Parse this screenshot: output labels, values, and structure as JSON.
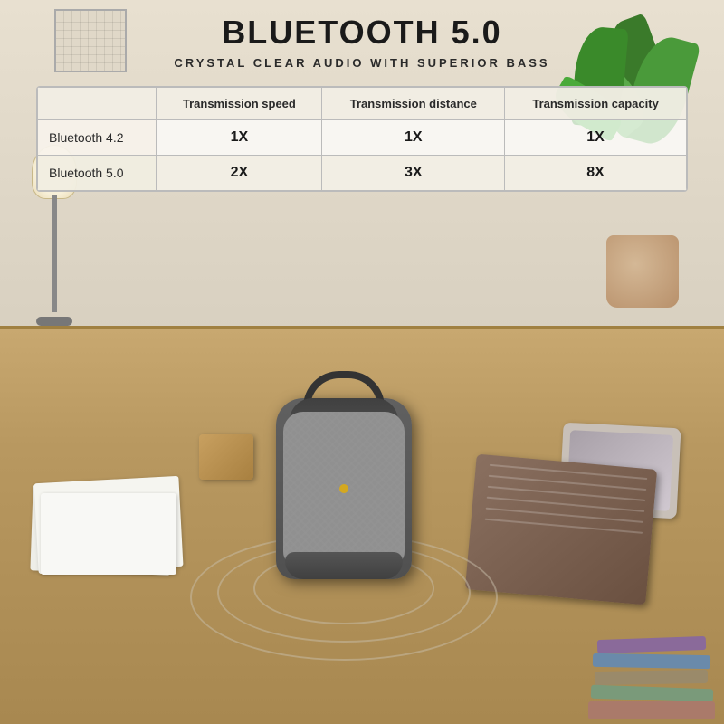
{
  "title": {
    "main": "BLUETOOTH 5.0",
    "sub": "CRYSTAL CLEAR AUDIO WITH SUPERIOR BASS"
  },
  "table": {
    "headers": [
      "",
      "Transmission speed",
      "Transmission distance",
      "Transmission capacity"
    ],
    "rows": [
      {
        "label": "Bluetooth 4.2",
        "speed": "1X",
        "distance": "1X",
        "capacity": "1X"
      },
      {
        "label": "Bluetooth 5.0",
        "speed": "2X",
        "distance": "3X",
        "capacity": "8X"
      }
    ]
  }
}
